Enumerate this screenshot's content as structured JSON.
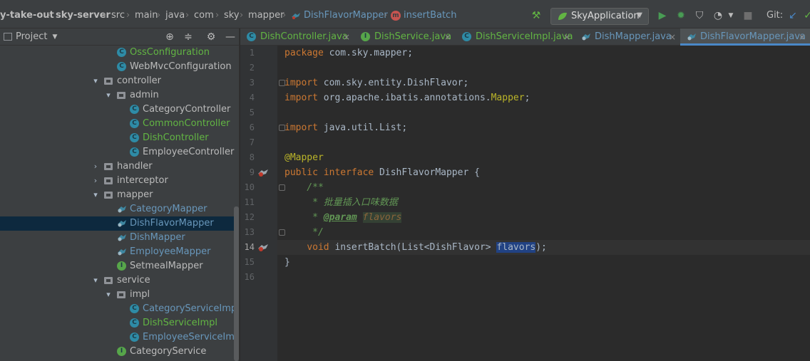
{
  "navbar": {
    "crumbs": [
      "y-take-out",
      "sky-server",
      "src",
      "main",
      "java",
      "com",
      "sky",
      "mapper",
      "DishFlavorMapper",
      "insertBatch"
    ],
    "run_config": "SkyApplication",
    "git_label": "Git:"
  },
  "project": {
    "title": "Project",
    "tree": [
      {
        "label": "OssConfiguration",
        "kind": "class",
        "color": "#62b543"
      },
      {
        "label": "WebMvcConfiguration",
        "kind": "class",
        "color": "#bbbbbb"
      },
      {
        "label": "controller",
        "kind": "package",
        "color": "#bbbbbb"
      },
      {
        "label": "admin",
        "kind": "package",
        "color": "#bbbbbb"
      },
      {
        "label": "CategoryController",
        "kind": "class",
        "color": "#bbbbbb"
      },
      {
        "label": "CommonController",
        "kind": "class",
        "color": "#62b543"
      },
      {
        "label": "DishController",
        "kind": "class",
        "color": "#62b543"
      },
      {
        "label": "EmployeeController",
        "kind": "class",
        "color": "#bbbbbb"
      },
      {
        "label": "handler",
        "kind": "package",
        "color": "#bbbbbb"
      },
      {
        "label": "interceptor",
        "kind": "package",
        "color": "#bbbbbb"
      },
      {
        "label": "mapper",
        "kind": "package",
        "color": "#bbbbbb"
      },
      {
        "label": "CategoryMapper",
        "kind": "mybatis",
        "color": "#6897bb"
      },
      {
        "label": "DishFlavorMapper",
        "kind": "mybatis",
        "color": "#6897bb"
      },
      {
        "label": "DishMapper",
        "kind": "mybatis",
        "color": "#6897bb"
      },
      {
        "label": "EmployeeMapper",
        "kind": "mybatis",
        "color": "#6897bb"
      },
      {
        "label": "SetmealMapper",
        "kind": "interface",
        "color": "#bbbbbb"
      },
      {
        "label": "service",
        "kind": "package",
        "color": "#bbbbbb"
      },
      {
        "label": "impl",
        "kind": "package",
        "color": "#bbbbbb"
      },
      {
        "label": "CategoryServiceImpl",
        "kind": "class",
        "color": "#6897bb"
      },
      {
        "label": "DishServiceImpl",
        "kind": "class",
        "color": "#62b543"
      },
      {
        "label": "EmployeeServiceImp",
        "kind": "class",
        "color": "#6897bb"
      },
      {
        "label": "CategoryService",
        "kind": "interface",
        "color": "#bbbbbb"
      }
    ]
  },
  "tabs": [
    {
      "label": "DishController.java",
      "kind": "class",
      "color": "#62b543"
    },
    {
      "label": "DishService.java",
      "kind": "interface",
      "color": "#62b543"
    },
    {
      "label": "DishServiceImpl.java",
      "kind": "class",
      "color": "#62b543"
    },
    {
      "label": "DishMapper.java",
      "kind": "mybatis",
      "color": "#6897bb"
    },
    {
      "label": "DishFlavorMapper.java",
      "kind": "mybatis",
      "color": "#6897bb"
    }
  ],
  "editor": {
    "line_numbers": [
      "1",
      "2",
      "3",
      "4",
      "5",
      "6",
      "7",
      "8",
      "9",
      "10",
      "11",
      "12",
      "13",
      "14",
      "15",
      "16"
    ],
    "code": {
      "l1_kw": "package",
      "l1_rest": " com.sky.mapper;",
      "l3_kw": "import",
      "l3_rest": " com.sky.entity.DishFlavor;",
      "l4_kw": "import",
      "l4_mid": " org.apache.ibatis.annotations.",
      "l4_ann": "Mapper",
      "l4_end": ";",
      "l6_kw": "import",
      "l6_rest": " java.util.List;",
      "l8_ann": "@Mapper",
      "l9_kw": "public interface",
      "l9_rest": " DishFlavorMapper {",
      "l10": "    /**",
      "l11": "     * 批量插入口味数据",
      "l12_pre": "     * ",
      "l12_tag": "@param",
      "l12_sp": " ",
      "l12_prm": "flavors",
      "l13": "     */",
      "l14_indent": "    ",
      "l14_kw": "void",
      "l14_mid": " insertBatch(List<DishFlavor> ",
      "l14_hl": "flavors",
      "l14_end": ");",
      "l15": "}"
    }
  },
  "colors": {
    "accent": "#4a88c7",
    "bg": "#2b2b2b",
    "panel": "#3c3f41",
    "selection": "#0d293e"
  }
}
